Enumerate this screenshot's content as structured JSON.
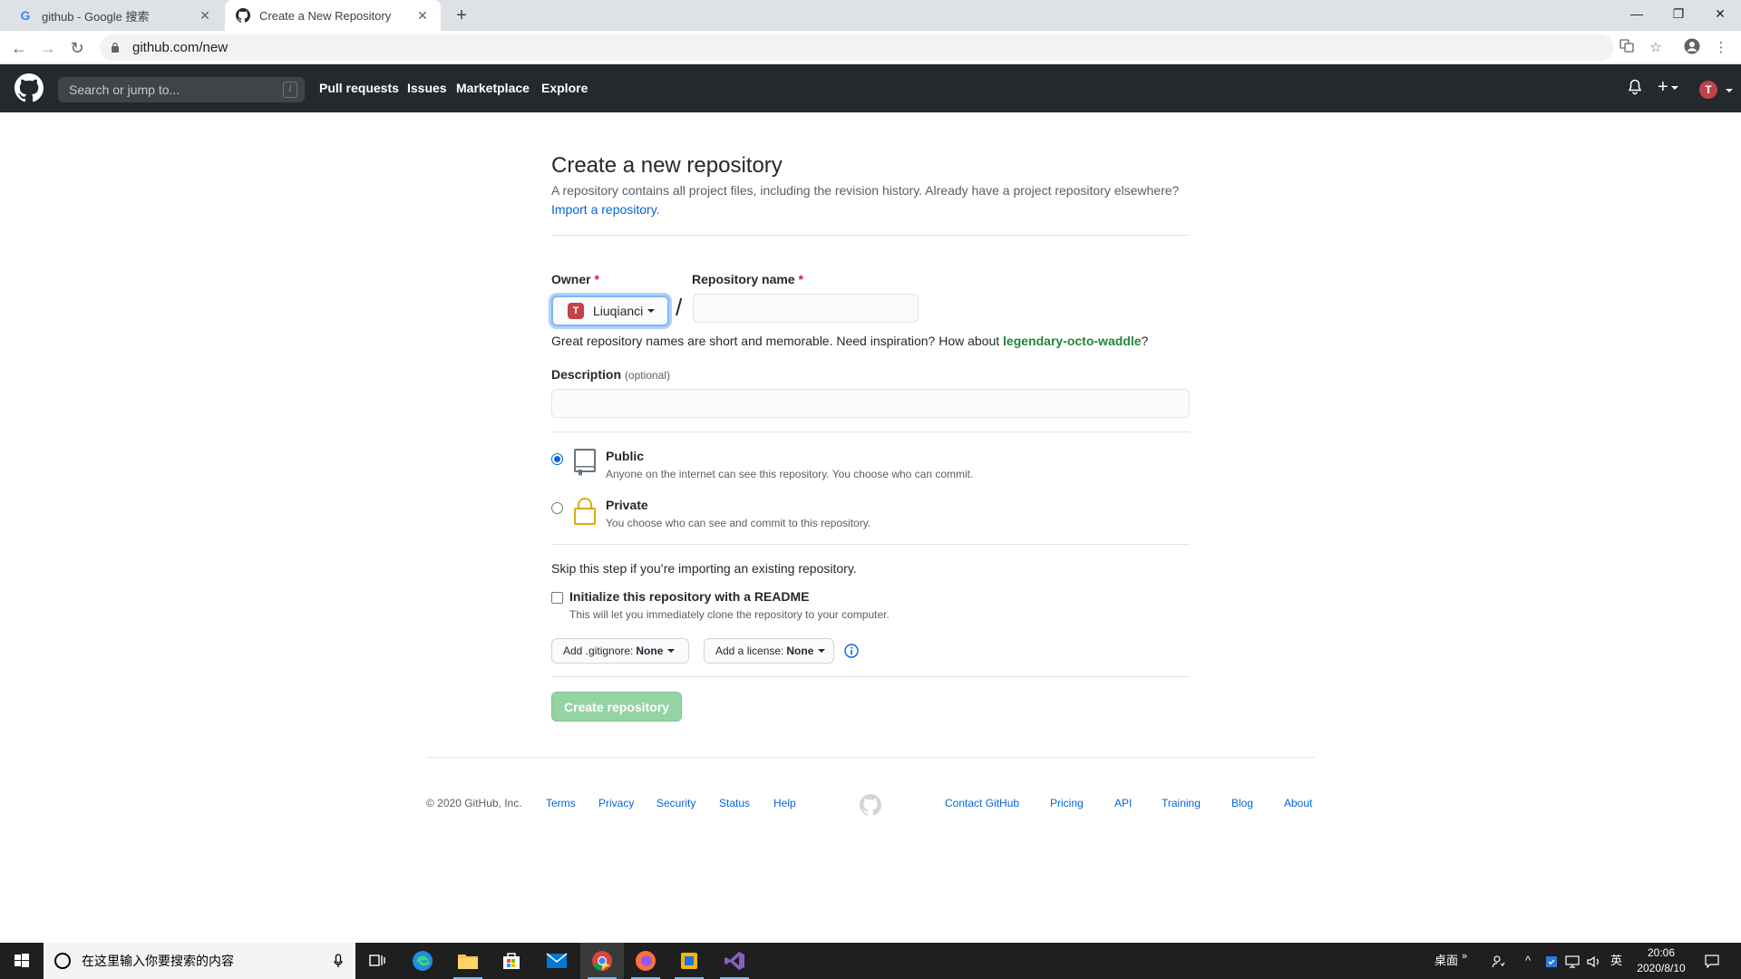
{
  "browser": {
    "tabs": [
      {
        "title": "github - Google 搜索",
        "favicon": "G"
      },
      {
        "title": "Create a New Repository",
        "favicon": "github-icon"
      }
    ],
    "url": "github.com/new"
  },
  "header": {
    "search_placeholder": "Search or jump to...",
    "search_shortcut": "/",
    "nav": [
      "Pull requests",
      "Issues",
      "Marketplace",
      "Explore"
    ],
    "avatar_letter": "T"
  },
  "page": {
    "title": "Create a new repository",
    "subhead": "A repository contains all project files, including the revision history. Already have a project repository elsewhere?",
    "import_link": "Import a repository.",
    "owner_label": "Owner",
    "required_mark": "*",
    "owner_value": "Liuqianci",
    "separator": "/",
    "repo_name_label": "Repository name",
    "repo_name_value": "",
    "hint_prefix": "Great repository names are short and memorable. Need inspiration? How about ",
    "hint_suggestion": "legendary-octo-waddle",
    "hint_suffix": "?",
    "description_label": "Description",
    "description_optional": "(optional)",
    "description_value": "",
    "visibility": {
      "selected": "public",
      "public_title": "Public",
      "public_desc": "Anyone on the internet can see this repository. You choose who can commit.",
      "private_title": "Private",
      "private_desc": "You choose who can see and commit to this repository."
    },
    "skip_text": "Skip this step if you’re importing an existing repository.",
    "readme_title": "Initialize this repository with a README",
    "readme_desc": "This will let you immediately clone the repository to your computer.",
    "readme_checked": false,
    "gitignore_label": "Add .gitignore:",
    "gitignore_value": "None",
    "license_label": "Add a license:",
    "license_value": "None",
    "create_button": "Create repository"
  },
  "footer": {
    "copyright": "© 2020 GitHub, Inc.",
    "left_links": [
      "Terms",
      "Privacy",
      "Security",
      "Status",
      "Help"
    ],
    "right_links": [
      "Contact GitHub",
      "Pricing",
      "API",
      "Training",
      "Blog",
      "About"
    ]
  },
  "taskbar": {
    "search_placeholder": "在这里输入你要搜索的内容",
    "desktop_label": "桌面",
    "ime": "英",
    "time": "20:06",
    "date": "2020/8/10"
  },
  "colors": {
    "gh_header": "#24292e",
    "link": "#0366d6",
    "create_button_disabled": "#94d3a2",
    "suggestion": "#22863a"
  }
}
